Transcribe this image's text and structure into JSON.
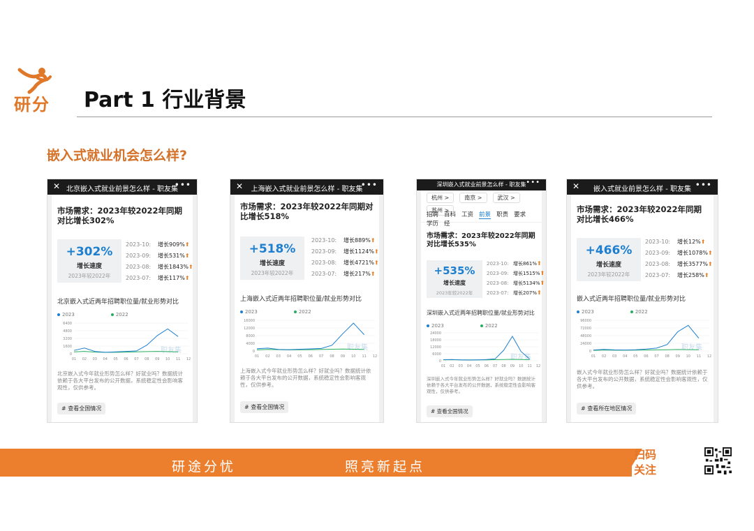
{
  "header": {
    "logo_text": "研分",
    "title": "Part 1 行业背景",
    "subtitle": "嵌入式就业机会怎么样?"
  },
  "icons": {
    "close": "close-icon",
    "more": "more-icon",
    "logo": "runner-logo-icon",
    "qr": "qr-code-icon"
  },
  "colors": {
    "accent": "#ec7f2e",
    "blue": "#1e7fd0",
    "green": "#27ae60"
  },
  "cards": [
    {
      "bar_title": "北京嵌入式就业前景怎么样 - 职友集",
      "headline": "市场需求：2023年较2022年同期对比增长302%",
      "pct": "+302%",
      "growth_label": "增长速度",
      "compare": "2023年较2022年",
      "stats": [
        {
          "month": "2023-10:",
          "growth": "增长909%"
        },
        {
          "month": "2023-09:",
          "growth": "增长531%"
        },
        {
          "month": "2023-08:",
          "growth": "增长1843%"
        },
        {
          "month": "2023-07:",
          "growth": "增长117%"
        }
      ],
      "chart_title": "北京嵌入式近两年招聘职位量/就业形势对比",
      "desc": "北京嵌入式今年就业形势怎么样？好就业吗？数据统计依赖于各大平台发布的公开数据，系统稳定性会影响客观性，仅供参考。",
      "tag": "# 查看全国情况"
    },
    {
      "bar_title": "上海嵌入式就业前景怎么样 - 职友集",
      "headline": "市场需求：2023年较2022年同期对比增长518%",
      "pct": "+518%",
      "growth_label": "增长速度",
      "compare": "2023年较2022年",
      "stats": [
        {
          "month": "2023-10:",
          "growth": "增长889%"
        },
        {
          "month": "2023-09:",
          "growth": "增长1124%"
        },
        {
          "month": "2023-08:",
          "growth": "增长4721%"
        },
        {
          "month": "2023-07:",
          "growth": "增长217%"
        }
      ],
      "chart_title": "上海嵌入式近两年招聘职位量/就业形势对比",
      "desc": "上海嵌入式今年就业形势怎么样？好就业吗？数据统计依赖于各大平台发布的公开数据，系统稳定性会影响客观性，仅供参考。",
      "tag": "# 查看全国情况"
    },
    {
      "bar_title": "深圳嵌入式就业前景怎么样 - 职友集",
      "cities": [
        "杭州 >",
        "南京 >",
        "武汉 >",
        "苏州 >"
      ],
      "nav": [
        "招聘",
        "百科",
        "工资",
        "前景",
        "职责",
        "要求",
        "学历",
        "经"
      ],
      "headline": "市场需求：2023年较2022年同期对比增长535%",
      "pct": "+535%",
      "growth_label": "增长速度",
      "compare": "2023年较2022年",
      "stats": [
        {
          "month": "2023-10:",
          "growth": "增长861%"
        },
        {
          "month": "2023-09:",
          "growth": "增长1515%"
        },
        {
          "month": "2023-08:",
          "growth": "增长5134%"
        },
        {
          "month": "2023-07:",
          "growth": "增长207%"
        }
      ],
      "chart_title": "深圳嵌入式近两年招聘职位量/就业形势对比",
      "desc": "深圳嵌入式今年就业形势怎么样？好就业吗？数据统计依赖于各大平台发布的公开数据，系统稳定性会影响客观性，仅供参考。",
      "tag": "# 查看全国情况"
    },
    {
      "bar_title": "嵌入式就业前景怎么样 - 职友集",
      "headline": "市场需求：2023年较2022年同期对比增长466%",
      "pct": "+466%",
      "growth_label": "增长速度",
      "compare": "2023年较2022年",
      "stats": [
        {
          "month": "2023-10:",
          "growth": "增长12%"
        },
        {
          "month": "2023-09:",
          "growth": "增长1078%"
        },
        {
          "month": "2023-08:",
          "growth": "增长3577%"
        },
        {
          "month": "2023-07:",
          "growth": "增长258%"
        }
      ],
      "chart_title": "嵌入式近两年招聘职位量/就业形势对比",
      "desc": "嵌入式今年就业形势怎么样？好就业吗？数据统计依赖于各大平台发布的公开数据，系统稳定性会影响客观性，仅供参考。",
      "tag": "# 查看所在地区情况"
    }
  ],
  "chart_common": {
    "legend": [
      "2023",
      "2022"
    ],
    "watermark": "职友集",
    "months": [
      "01",
      "02",
      "03",
      "04",
      "05",
      "06",
      "07",
      "08",
      "09",
      "10",
      "11",
      "12"
    ]
  },
  "charts": [
    {
      "yticks": [
        "6400",
        "4800",
        "3200",
        "1600",
        "0"
      ],
      "ymax": 6400,
      "s2023": [
        700,
        1200,
        500,
        300,
        400,
        500,
        600,
        1800,
        3800,
        5200,
        3600,
        null
      ],
      "s2022": [
        400,
        500,
        350,
        300,
        300,
        350,
        400,
        450,
        500,
        450,
        400,
        null
      ]
    },
    {
      "yticks": [
        "16000",
        "12000",
        "8000",
        "4000",
        "0"
      ],
      "ymax": 16000,
      "s2023": [
        1200,
        1500,
        800,
        700,
        900,
        1100,
        1300,
        3000,
        9000,
        14500,
        8500,
        null
      ],
      "s2022": [
        600,
        800,
        700,
        600,
        650,
        700,
        800,
        900,
        1000,
        900,
        800,
        null
      ]
    },
    {
      "yticks": [
        "24000",
        "18000",
        "12000",
        "6000",
        "0"
      ],
      "ymax": 24000,
      "s2023": [
        900,
        1100,
        700,
        600,
        800,
        1000,
        1600,
        9000,
        21000,
        8000,
        1500,
        null
      ],
      "s2022": [
        700,
        900,
        800,
        700,
        700,
        800,
        900,
        1000,
        1200,
        1100,
        900,
        null
      ]
    },
    {
      "yticks": [
        "96000",
        "72000",
        "48000",
        "24000",
        "0"
      ],
      "ymax": 96000,
      "s2023": [
        3000,
        5000,
        3500,
        3000,
        4000,
        6000,
        9000,
        20000,
        60000,
        80000,
        40000,
        null
      ],
      "s2022": [
        2000,
        3000,
        2500,
        2500,
        2800,
        3000,
        3500,
        4000,
        4500,
        4200,
        3800,
        null
      ]
    }
  ],
  "footer": {
    "slogan_left": "研途分忧",
    "slogan_right": "照亮新起点",
    "scan_line1": "扫码",
    "scan_line2": "关注"
  }
}
